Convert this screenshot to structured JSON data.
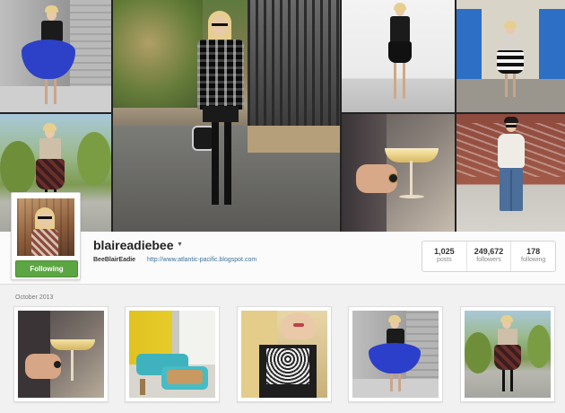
{
  "profile": {
    "username": "blaireadiebee",
    "full_name": "BeeBlairEadie",
    "website": "http://www.atlantic-pacific.blogspot.com",
    "follow_label": "Following"
  },
  "stats": [
    {
      "value": "1,025",
      "label": "posts"
    },
    {
      "value": "249,672",
      "label": "followers"
    },
    {
      "value": "178",
      "label": "following"
    }
  ],
  "section": {
    "label": "October 2013"
  },
  "colors": {
    "follow_green": "#5ba642",
    "link_blue": "#3f729b"
  }
}
